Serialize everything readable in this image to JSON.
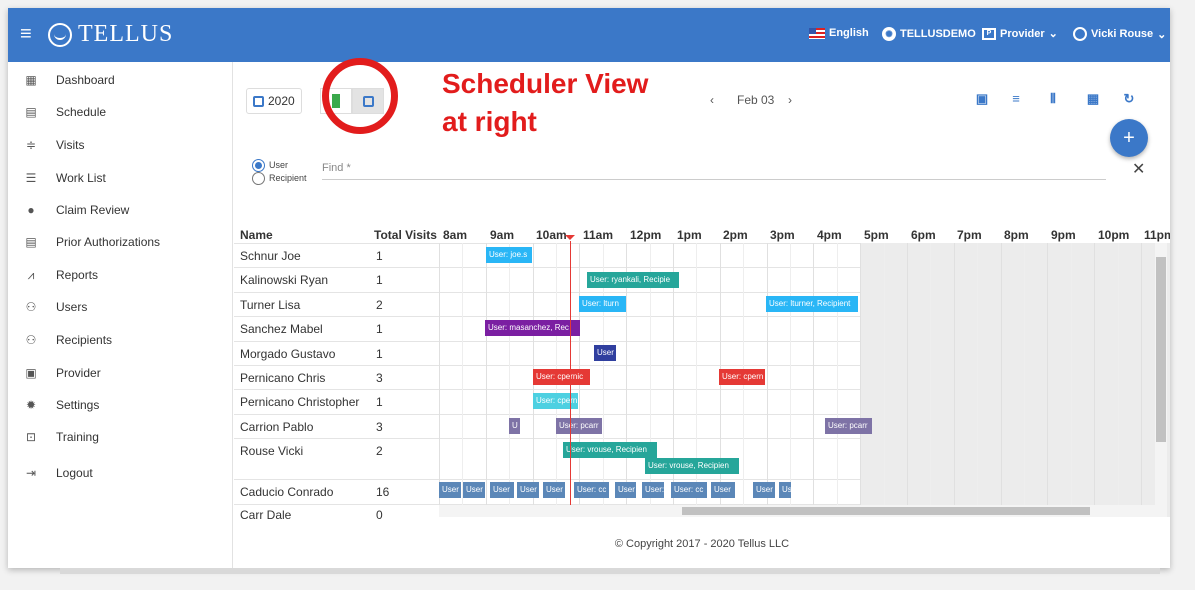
{
  "topbar": {
    "app_name": "TELLUS",
    "language": "English",
    "org": "TELLUSDEMO",
    "role": "Provider",
    "user": "Vicki Rouse"
  },
  "sidebar": {
    "items": [
      {
        "label": "Dashboard",
        "icon": "dashboard-icon"
      },
      {
        "label": "Schedule",
        "icon": "calendar-icon"
      },
      {
        "label": "Visits",
        "icon": "filter-icon"
      },
      {
        "label": "Work List",
        "icon": "list-icon"
      },
      {
        "label": "Claim Review",
        "icon": "alert-icon"
      },
      {
        "label": "Prior Authorizations",
        "icon": "calendar-icon"
      },
      {
        "label": "Reports",
        "icon": "trend-icon"
      },
      {
        "label": "Users",
        "icon": "people-icon"
      },
      {
        "label": "Recipients",
        "icon": "people-outline-icon"
      },
      {
        "label": "Provider",
        "icon": "document-icon"
      },
      {
        "label": "Settings",
        "icon": "gear-icon"
      },
      {
        "label": "Training",
        "icon": "training-icon"
      },
      {
        "label": "Logout",
        "icon": "logout-icon"
      }
    ]
  },
  "toolbar": {
    "year": "2020",
    "date": "Feb 03"
  },
  "filters": {
    "user_label": "User",
    "recipient_label": "Recipient",
    "find_placeholder": "Find *"
  },
  "grid": {
    "col_name": "Name",
    "col_visits": "Total Visits",
    "hours": [
      "8am",
      "9am",
      "10am",
      "11am",
      "12pm",
      "1pm",
      "2pm",
      "3pm",
      "4pm",
      "5pm",
      "6pm",
      "7pm",
      "8pm",
      "9pm",
      "10pm",
      "11pm"
    ],
    "rows": [
      {
        "name": "Schnur Joe",
        "visits": "1"
      },
      {
        "name": "Kalinowski Ryan",
        "visits": "1"
      },
      {
        "name": "Turner Lisa",
        "visits": "2"
      },
      {
        "name": "Sanchez Mabel",
        "visits": "1"
      },
      {
        "name": "Morgado Gustavo",
        "visits": "1"
      },
      {
        "name": "Pernicano Chris",
        "visits": "3"
      },
      {
        "name": "Pernicano Christopher",
        "visits": "1"
      },
      {
        "name": "Carrion Pablo",
        "visits": "3"
      },
      {
        "name": "Rouse Vicki",
        "visits": "2"
      },
      {
        "name": "Caducio Conrado",
        "visits": "16"
      },
      {
        "name": "Carr Dale",
        "visits": "0"
      }
    ],
    "events": [
      {
        "text": "User: joe.s",
        "color": "#29b6f6"
      },
      {
        "text": "User: ryankali, Recipie",
        "color": "#26a69a"
      },
      {
        "text": "User: lturn",
        "color": "#29b6f6"
      },
      {
        "text": "User: lturner, Recipient",
        "color": "#29b6f6"
      },
      {
        "text": "User: masanchez, Rec",
        "color": "#7b1fa2"
      },
      {
        "text": "User",
        "color": "#303f9f"
      },
      {
        "text": "User: cpernic",
        "color": "#e53935"
      },
      {
        "text": "User: cpern",
        "color": "#e53935"
      },
      {
        "text": "User: cpern",
        "color": "#4dd0e1"
      },
      {
        "text": "U",
        "color": "#7e73a6"
      },
      {
        "text": "User: pcarr",
        "color": "#7e73a6"
      },
      {
        "text": "User: pcarr",
        "color": "#7e73a6"
      },
      {
        "text": "User: vrouse, Recipien",
        "color": "#26a69a"
      },
      {
        "text": "User: vrouse, Recipien",
        "color": "#26a69a"
      },
      {
        "text": "User",
        "color": "#5b87b8"
      },
      {
        "text": "User",
        "color": "#5b87b8"
      },
      {
        "text": "User",
        "color": "#5b87b8"
      },
      {
        "text": "User",
        "color": "#5b87b8"
      },
      {
        "text": "User",
        "color": "#5b87b8"
      },
      {
        "text": "User: cc",
        "color": "#5b87b8"
      },
      {
        "text": "User",
        "color": "#5b87b8"
      },
      {
        "text": "User:",
        "color": "#5b87b8"
      },
      {
        "text": "User: cc",
        "color": "#5b87b8"
      },
      {
        "text": "User",
        "color": "#5b87b8"
      },
      {
        "text": "User",
        "color": "#5b87b8"
      },
      {
        "text": "Us",
        "color": "#5b87b8"
      }
    ]
  },
  "footer": {
    "copyright": "© Copyright 2017 - 2020 Tellus LLC"
  },
  "annotation": {
    "line1": "Scheduler View",
    "line2": "at right"
  }
}
